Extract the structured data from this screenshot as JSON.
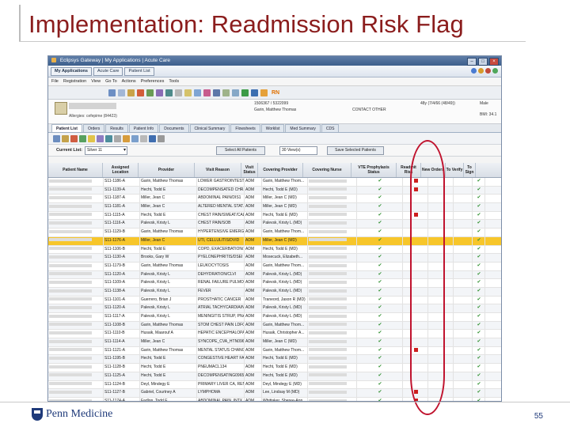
{
  "slide": {
    "title": "Implementation: Readmission Risk Flag",
    "footer_logo": "Penn Medicine",
    "page_number": "55"
  },
  "app": {
    "window_title": "Eclipsys Gateway | My Applications | Acute Care",
    "nav_buttons": [
      "My Applications",
      "Acute Care",
      "Patient List"
    ],
    "menu": [
      "File",
      "Registration",
      "View",
      "Go To",
      "Actions",
      "Preferences",
      "Tools"
    ],
    "rn_label": "RN",
    "patient": {
      "mrn": "1506367 / 5322099",
      "name": "Garin, Matthew Thomas",
      "contact": "CONTACT OTHER",
      "age": "48y (7/4/66 (48/49))",
      "sex": "Male",
      "bmi": "BMI: 34.1",
      "allergies": "Allergies: cefepime (84423)"
    },
    "tabs": [
      "Patient List",
      "Orders",
      "Results",
      "Patient Info",
      "Documents",
      "Clinical Summary",
      "Flowsheets",
      "Worklist",
      "Med Summary",
      "CDS"
    ],
    "filter": {
      "label": "Current List:",
      "value": "Silver 11",
      "select_all": "Select All Patients",
      "view_label": "30 View(s)",
      "save_selected": "Save Selected Patients"
    },
    "columns": [
      "Patient Name",
      "Assigned Location",
      "Provider",
      "Visit Reason",
      "Visit Status",
      "Covering Provider",
      "Covering Nurse",
      "VTE Prophylaxis Status",
      "Readmit Risk",
      "New Orders",
      "To Verify",
      "To Sign"
    ],
    "rows": [
      {
        "loc": "S11-1186-A",
        "prov": "Garin, Matthew Thomas",
        "reason": "LOWER GASTROINTESTI...",
        "status": "ADM",
        "cov": "Garin, Matthew Thom...",
        "risk": true
      },
      {
        "loc": "S11-1139-A",
        "prov": "Hecht, Todd E",
        "reason": "DECOMPENSATED CHR...",
        "status": "ADM",
        "cov": "Hecht, Todd E (MD)",
        "risk": true
      },
      {
        "loc": "S11-1187-A",
        "prov": "Miller, Jean C",
        "reason": "ABDOMINAL PAIN/DIS1",
        "status": "ADM",
        "cov": "Miller, Jean C (MD)",
        "risk": false
      },
      {
        "loc": "S11-1181-A",
        "prov": "Miller, Jean C",
        "reason": "ALTERED MENTAL STAT...",
        "status": "ADM",
        "cov": "Miller, Jean C (MD)",
        "risk": false
      },
      {
        "loc": "S11-1115-A",
        "prov": "Hecht, Todd E",
        "reason": "CHEST PAIN/SWEAT/CAL...",
        "status": "ADM",
        "cov": "Hecht, Todd E (MD)",
        "risk": true
      },
      {
        "loc": "S11-1116-A",
        "prov": "Palevsk, Kristy L",
        "reason": "CHEST PAIN/SOB",
        "status": "ADM",
        "cov": "Palevsk, Kristy L (MD)",
        "risk": false
      },
      {
        "loc": "S11-1129-B",
        "prov": "Garin, Matthew Thomas",
        "reason": "HYPERTENSIVE EMERGEN...",
        "status": "ADM",
        "cov": "Garin, Matthew Thom...",
        "risk": false
      },
      {
        "loc": "S11-1176-A",
        "prov": "Miller, Jean C",
        "reason": "UTI, CELLULITIS/DVID",
        "status": "ADM",
        "cov": "Miller, Jean C (MD)",
        "risk": false,
        "highlight": true
      },
      {
        "loc": "S11-1106-B",
        "prov": "Hecht, Todd E",
        "reason": "COPD, EXACERBATION/...",
        "status": "ADM",
        "cov": "Hecht, Todd E (MD)",
        "risk": false
      },
      {
        "loc": "S11-1130-A",
        "prov": "Brooks, Gary W",
        "reason": "PYELONEPHRITIS/DSEI",
        "status": "ADM",
        "cov": "Mosecuck, Elizabeth...",
        "risk": false
      },
      {
        "loc": "S11-1179-B",
        "prov": "Garin, Matthew Thomas",
        "reason": "LEUKOCYTOSIS",
        "status": "ADM",
        "cov": "Garin, Matthew Thom...",
        "risk": false
      },
      {
        "loc": "S11-1120-A",
        "prov": "Palevsk, Kristy L",
        "reason": "DEHYDRATION/CLVI",
        "status": "ADM",
        "cov": "Palevsk, Kristy L (MD)",
        "risk": false
      },
      {
        "loc": "S11-1109-A",
        "prov": "Palevsk, Kristy L",
        "reason": "RENAL FAILURE PULMON...",
        "status": "ADM",
        "cov": "Palevsk, Kristy L (MD)",
        "risk": false
      },
      {
        "loc": "S11-1138-A",
        "prov": "Palevsk, Kristy L",
        "reason": "FEVER",
        "status": "ADM",
        "cov": "Palevsk, Kristy L (MD)",
        "risk": false
      },
      {
        "loc": "S11-1101-A",
        "prov": "Guerrero, Brian J",
        "reason": "PROSTHATIC CANCER",
        "status": "ADM",
        "cov": "Traneord, Jason R (MD)",
        "risk": false
      },
      {
        "loc": "S11-1120-A",
        "prov": "Palevsk, Kristy L",
        "reason": "ATRIAL TACHYCARDIA/N...",
        "status": "ADM",
        "cov": "Palevsk, Kristy L (MD)",
        "risk": false
      },
      {
        "loc": "S11-1117-A",
        "prov": "Palevsk, Kristy L",
        "reason": "MENINGITIS STRUP, PNA...",
        "status": "ADM",
        "cov": "Palevsk, Kristy L (MD)",
        "risk": false
      },
      {
        "loc": "S11-1108-B",
        "prov": "Garin, Matthew Thomas",
        "reason": "STOM CHEST PAIN LDFO",
        "status": "ADM",
        "cov": "Garin, Matthew Thom...",
        "risk": false
      },
      {
        "loc": "S11-1110-B",
        "prov": "Husaik, Maarouf A",
        "reason": "HEPATIC ENCEPHALOPA...",
        "status": "ADM",
        "cov": "Husaik, Christopher A...",
        "risk": false
      },
      {
        "loc": "S11-1114-A",
        "prov": "Miller, Jean C",
        "reason": "SYNCOPE_CVA_HTN0960",
        "status": "ADM",
        "cov": "Miller, Jean C (MD)",
        "risk": false
      },
      {
        "loc": "S11-1121-A",
        "prov": "Garin, Matthew Thomas",
        "reason": "MENTAL STATUS CHANG...",
        "status": "ADM",
        "cov": "Garin, Matthew Thom...",
        "risk": true
      },
      {
        "loc": "S11-1195-B",
        "prov": "Hecht, Todd E",
        "reason": "CONGESTIVE HEART FAI...",
        "status": "ADM",
        "cov": "Hecht, Todd E (MD)",
        "risk": false
      },
      {
        "loc": "S11-1128-B",
        "prov": "Hecht, Todd E",
        "reason": "PNEUMACL134",
        "status": "ADM",
        "cov": "Hecht, Todd E (MD)",
        "risk": false
      },
      {
        "loc": "S11-1125-A",
        "prov": "Hecht, Todd E",
        "reason": "DECOMPENSATING0965",
        "status": "ADM",
        "cov": "Hecht, Todd E (MD)",
        "risk": false
      },
      {
        "loc": "S11-1124-B",
        "prov": "Deyl, Mindegy E",
        "reason": "PRIMARY LIVER CA, REN...",
        "status": "ADM",
        "cov": "Deyl, Mindegy E (MD)",
        "risk": false
      },
      {
        "loc": "S11-1127-B",
        "prov": "Gabriel, Courtney A",
        "reason": "LYMPHOMA",
        "status": "ADM",
        "cov": "Lee, Lindsay M (MD)",
        "risk": true
      },
      {
        "loc": "S11-1174-A",
        "prov": "Fadlon, Todd E",
        "reason": "ABDOMINAL PAIN, INTX...",
        "status": "ADM",
        "cov": "Whittaker, Sheree-Ann...",
        "risk": true
      }
    ]
  },
  "colors": {
    "title": "#8b1d1d",
    "risk_flag": "#cc1f1f",
    "highlight_row": "#f7c62a",
    "oval": "#c0132e",
    "brand": "#1f3a7a"
  }
}
